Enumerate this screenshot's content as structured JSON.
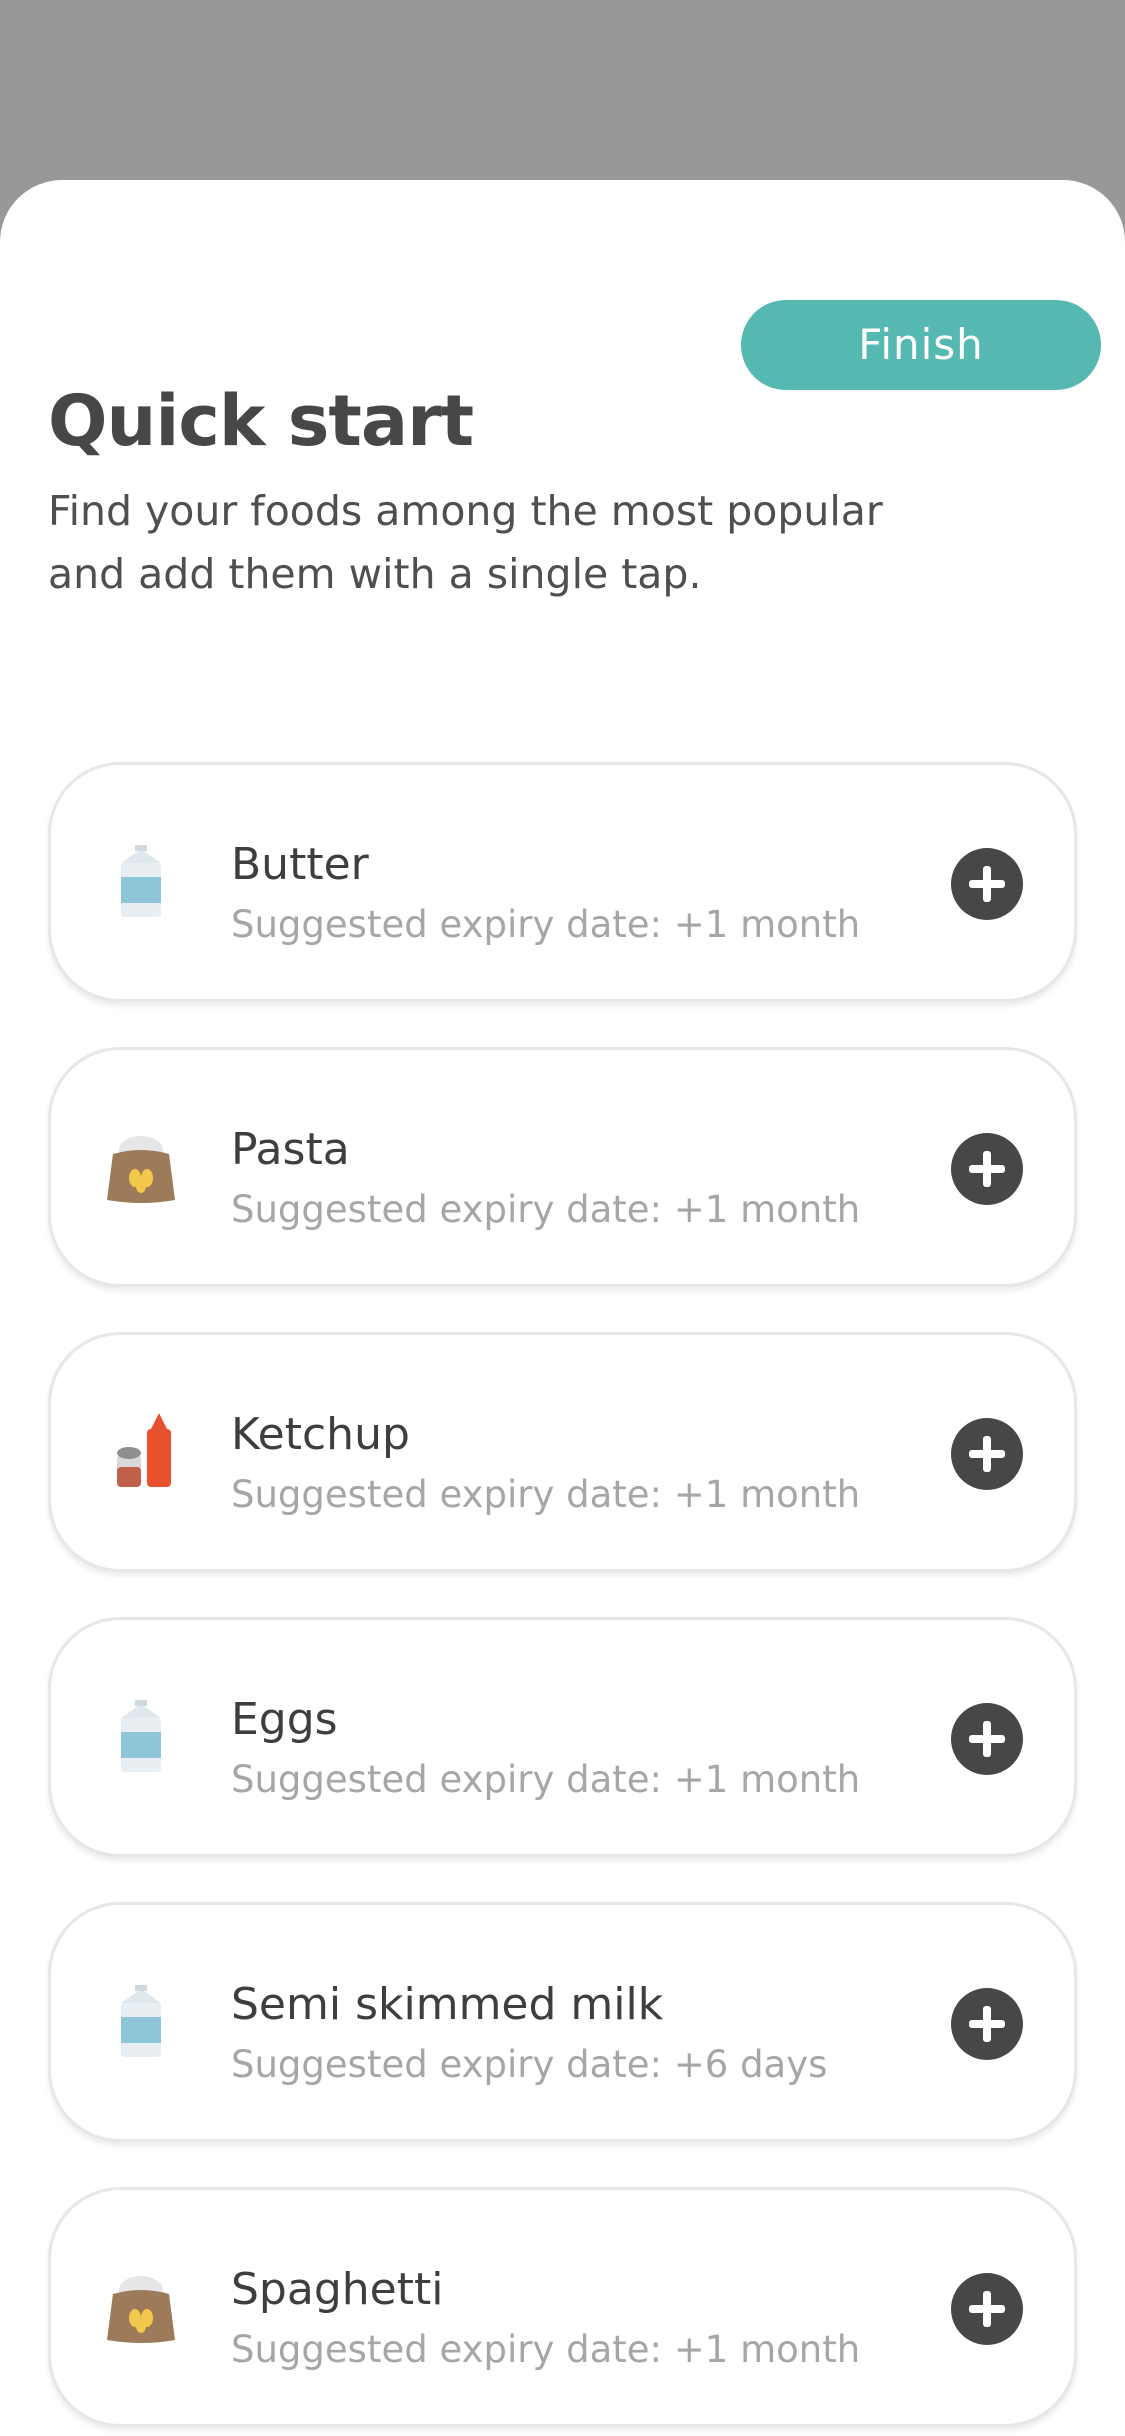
{
  "finish_button": {
    "label": "Finish"
  },
  "header": {
    "title": "Quick start",
    "subtitle": "Find your foods among the most popular and add them with a single tap."
  },
  "foods": [
    {
      "name": "Butter",
      "expiry": "Suggested expiry date: +1 month",
      "icon": "milk-carton-icon"
    },
    {
      "name": "Pasta",
      "expiry": "Suggested expiry date: +1 month",
      "icon": "grain-sack-icon"
    },
    {
      "name": "Ketchup",
      "expiry": "Suggested expiry date: +1 month",
      "icon": "condiments-icon"
    },
    {
      "name": "Eggs",
      "expiry": "Suggested expiry date: +1 month",
      "icon": "milk-carton-icon"
    },
    {
      "name": "Semi skimmed milk",
      "expiry": "Suggested expiry date: +6 days",
      "icon": "milk-carton-icon"
    },
    {
      "name": "Spaghetti",
      "expiry": "Suggested expiry date: +1 month",
      "icon": "grain-sack-icon"
    }
  ],
  "colors": {
    "overlay": "#989898",
    "accent": "#55b8b1",
    "add_button": "#474747",
    "title": "#474747",
    "secondary_text": "#a6a6a6"
  }
}
